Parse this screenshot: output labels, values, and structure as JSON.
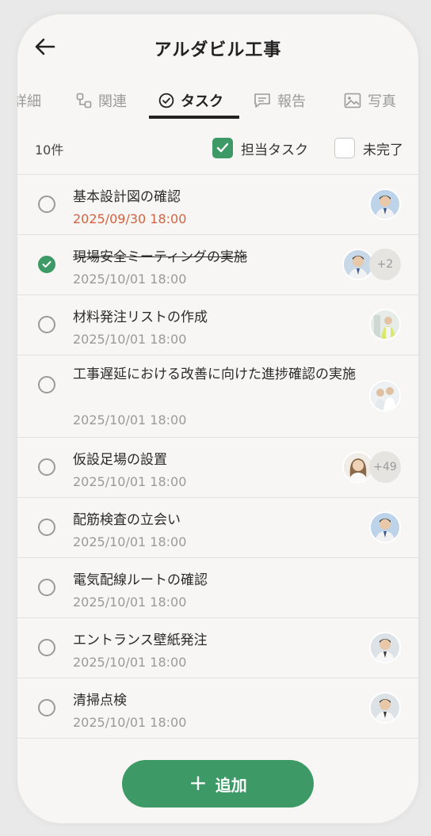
{
  "header": {
    "title": "アルダビル工事",
    "back_icon": "arrow-left-icon"
  },
  "tabs": [
    {
      "label": "詳細",
      "icon": ""
    },
    {
      "label": "関連",
      "icon": "link-nodes-icon"
    },
    {
      "label": "タスク",
      "icon": "check-circle-icon",
      "active": true
    },
    {
      "label": "報告",
      "icon": "comment-icon"
    },
    {
      "label": "写真",
      "icon": "image-icon"
    }
  ],
  "filter": {
    "count": "10件",
    "assigned_label": "担当タスク",
    "assigned_checked": true,
    "incomplete_label": "未完了",
    "incomplete_checked": false
  },
  "tasks": [
    {
      "title": "基本設計図の確認",
      "date": "2025/09/30 18:00",
      "overdue": true,
      "done": false,
      "extra": ""
    },
    {
      "title": "現場安全ミーティングの実施",
      "date": "2025/10/01 18:00",
      "overdue": false,
      "done": true,
      "extra": "+2"
    },
    {
      "title": "材料発注リストの作成",
      "date": "2025/10/01 18:00",
      "overdue": false,
      "done": false,
      "extra": ""
    },
    {
      "title": "工事遅延における改善に向けた進捗確認の実施",
      "date": "2025/10/01 18:00",
      "overdue": false,
      "done": false,
      "extra": ""
    },
    {
      "title": "仮設足場の設置",
      "date": "2025/10/01 18:00",
      "overdue": false,
      "done": false,
      "extra": "+49"
    },
    {
      "title": "配筋検査の立会い",
      "date": "2025/10/01 18:00",
      "overdue": false,
      "done": false,
      "extra": ""
    },
    {
      "title": "電気配線ルートの確認",
      "date": "2025/10/01 18:00",
      "overdue": false,
      "done": false,
      "extra": ""
    },
    {
      "title": "エントランス壁紙発注",
      "date": "2025/10/01 18:00",
      "overdue": false,
      "done": false,
      "extra": ""
    },
    {
      "title": "清掃点検",
      "date": "2025/10/01 18:00",
      "overdue": false,
      "done": false,
      "extra": ""
    }
  ],
  "add_button": {
    "label": "追加",
    "icon": "plus-icon"
  },
  "colors": {
    "accent": "#3d9a66",
    "overdue": "#d3623f"
  }
}
